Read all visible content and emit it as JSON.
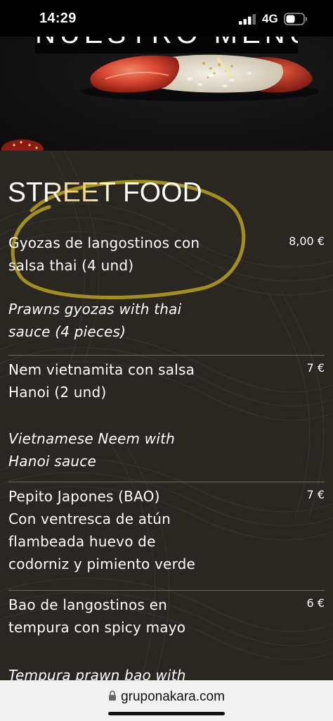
{
  "status_bar": {
    "time": "14:29",
    "network": "4G"
  },
  "hero": {
    "title": "NUESTRO MENU"
  },
  "section": {
    "title": "STREET FOOD"
  },
  "items": [
    {
      "name": "Gyozas de langostinos con salsa thai (4 und)",
      "price": "8,00 €",
      "description": "",
      "english": "Prawns gyozas with thai sauce (4 pieces)"
    },
    {
      "name": "Nem vietnamita con salsa Hanoi (2 und)",
      "price": "7 €",
      "description": "",
      "english": "Vietnamese Neem with Hanoi sauce"
    },
    {
      "name": "Pepito Japones (BAO)",
      "price": "7 €",
      "description": "Con ventresca de atún flambeada huevo de codorniz y pimiento verde",
      "english": ""
    },
    {
      "name": "Bao de langostinos en tempura con spicy mayo",
      "price": "6 €",
      "description": "",
      "english": "Tempura prawn bao with"
    }
  ],
  "browser": {
    "url": "gruponakara.com"
  },
  "icons": {
    "signal": "signal-bars-icon",
    "battery": "battery-icon",
    "lock": "lock-icon"
  },
  "colors": {
    "accent_gold": "#e9c76a",
    "background": "#2a2622",
    "text": "#ffffff"
  }
}
